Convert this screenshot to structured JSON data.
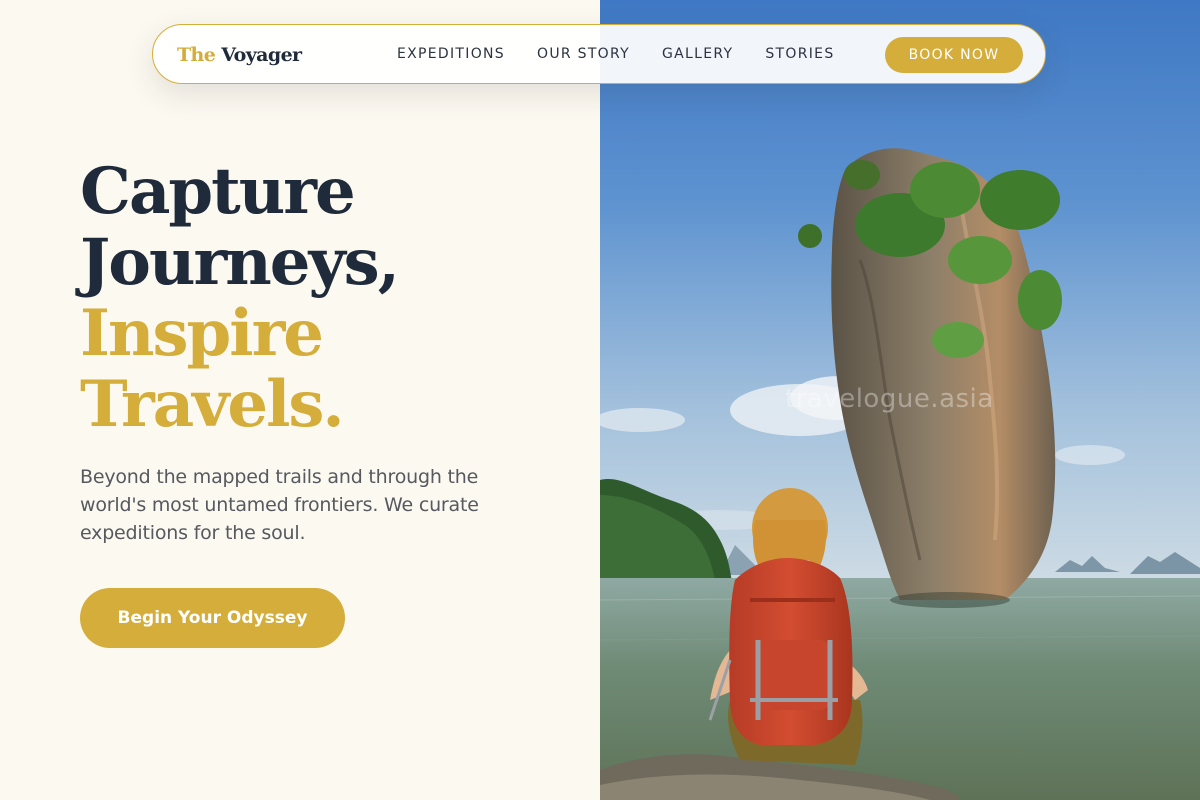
{
  "brand": {
    "prefix": "The",
    "name": "Voyager"
  },
  "nav": {
    "items": [
      {
        "label": "EXPEDITIONS"
      },
      {
        "label": "OUR STORY"
      },
      {
        "label": "GALLERY"
      },
      {
        "label": "STORIES"
      }
    ],
    "cta_label": "BOOK NOW"
  },
  "hero": {
    "headline_line1": "Capture",
    "headline_line2": "Journeys,",
    "headline_line3": "Inspire",
    "headline_line4": "Travels.",
    "description": "Beyond the mapped trails and through the world's most untamed frontiers. We curate expeditions for the soul.",
    "cta_label": "Begin Your Odyssey",
    "image_watermark": "travelogue.asia"
  },
  "colors": {
    "accent_gold": "#d4ad3b",
    "text_dark": "#1f2a3a",
    "background": "#fcf9f1"
  },
  "icons": {
    "hero_image": "backpacker-rock-sea-photo"
  }
}
